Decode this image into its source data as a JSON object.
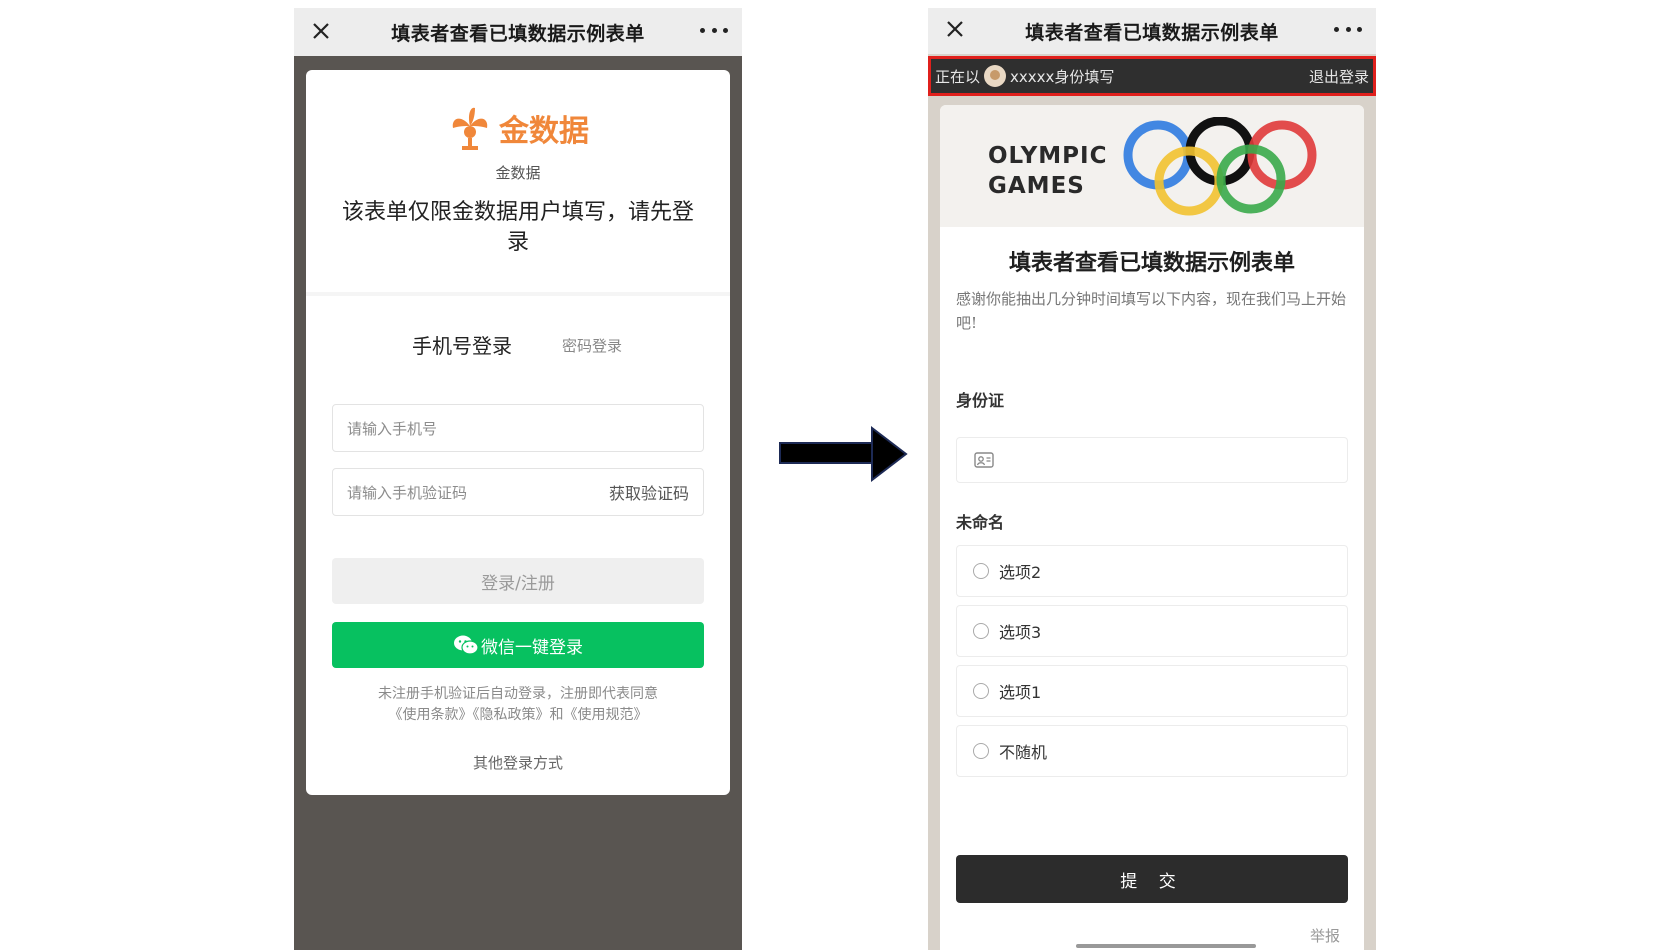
{
  "left_phone": {
    "title": "填表者查看已填数据示例表单",
    "brand_name": "金数据",
    "brand_subtitle": "金数据",
    "notice": "该表单仅限金数据用户填写，请先登录",
    "tabs": {
      "phone_login": "手机号登录",
      "password_login": "密码登录"
    },
    "phone_input": {
      "placeholder": "请输入手机号"
    },
    "code_input": {
      "placeholder": "请输入手机验证码",
      "action": "获取验证码"
    },
    "login_button": "登录/注册",
    "wechat_button": "微信一键登录",
    "terms_line1": "未注册手机验证后自动登录，注册即代表同意",
    "terms_line2": "《使用条款》《隐私政策》和《使用规范》",
    "other_methods": "其他登录方式"
  },
  "right_phone": {
    "title": "填表者查看已填数据示例表单",
    "login_bar": {
      "prefix": "正在以",
      "identity": "xxxxx身份填写",
      "logout": "退出登录"
    },
    "banner": {
      "line1": "OLYMPIC",
      "line2": "GAMES"
    },
    "form_title": "填表者查看已填数据示例表单",
    "form_desc": "感谢你能抽出几分钟时间填写以下内容，现在我们马上开始吧!",
    "questions": [
      {
        "label": "身份证"
      },
      {
        "label": "未命名",
        "options": [
          "选项2",
          "选项3",
          "选项1",
          "不随机"
        ]
      }
    ],
    "submit": "提 交",
    "report": "举报"
  },
  "colors": {
    "brand_orange": "#f0873a",
    "wechat_green": "#07c160",
    "highlight_red": "#e0201c",
    "submit_dark": "#2c2c2c"
  },
  "icons": [
    "close-icon",
    "more-icon",
    "wechat-icon",
    "id-card-icon",
    "arrow-right-icon",
    "olympic-rings-icon"
  ]
}
